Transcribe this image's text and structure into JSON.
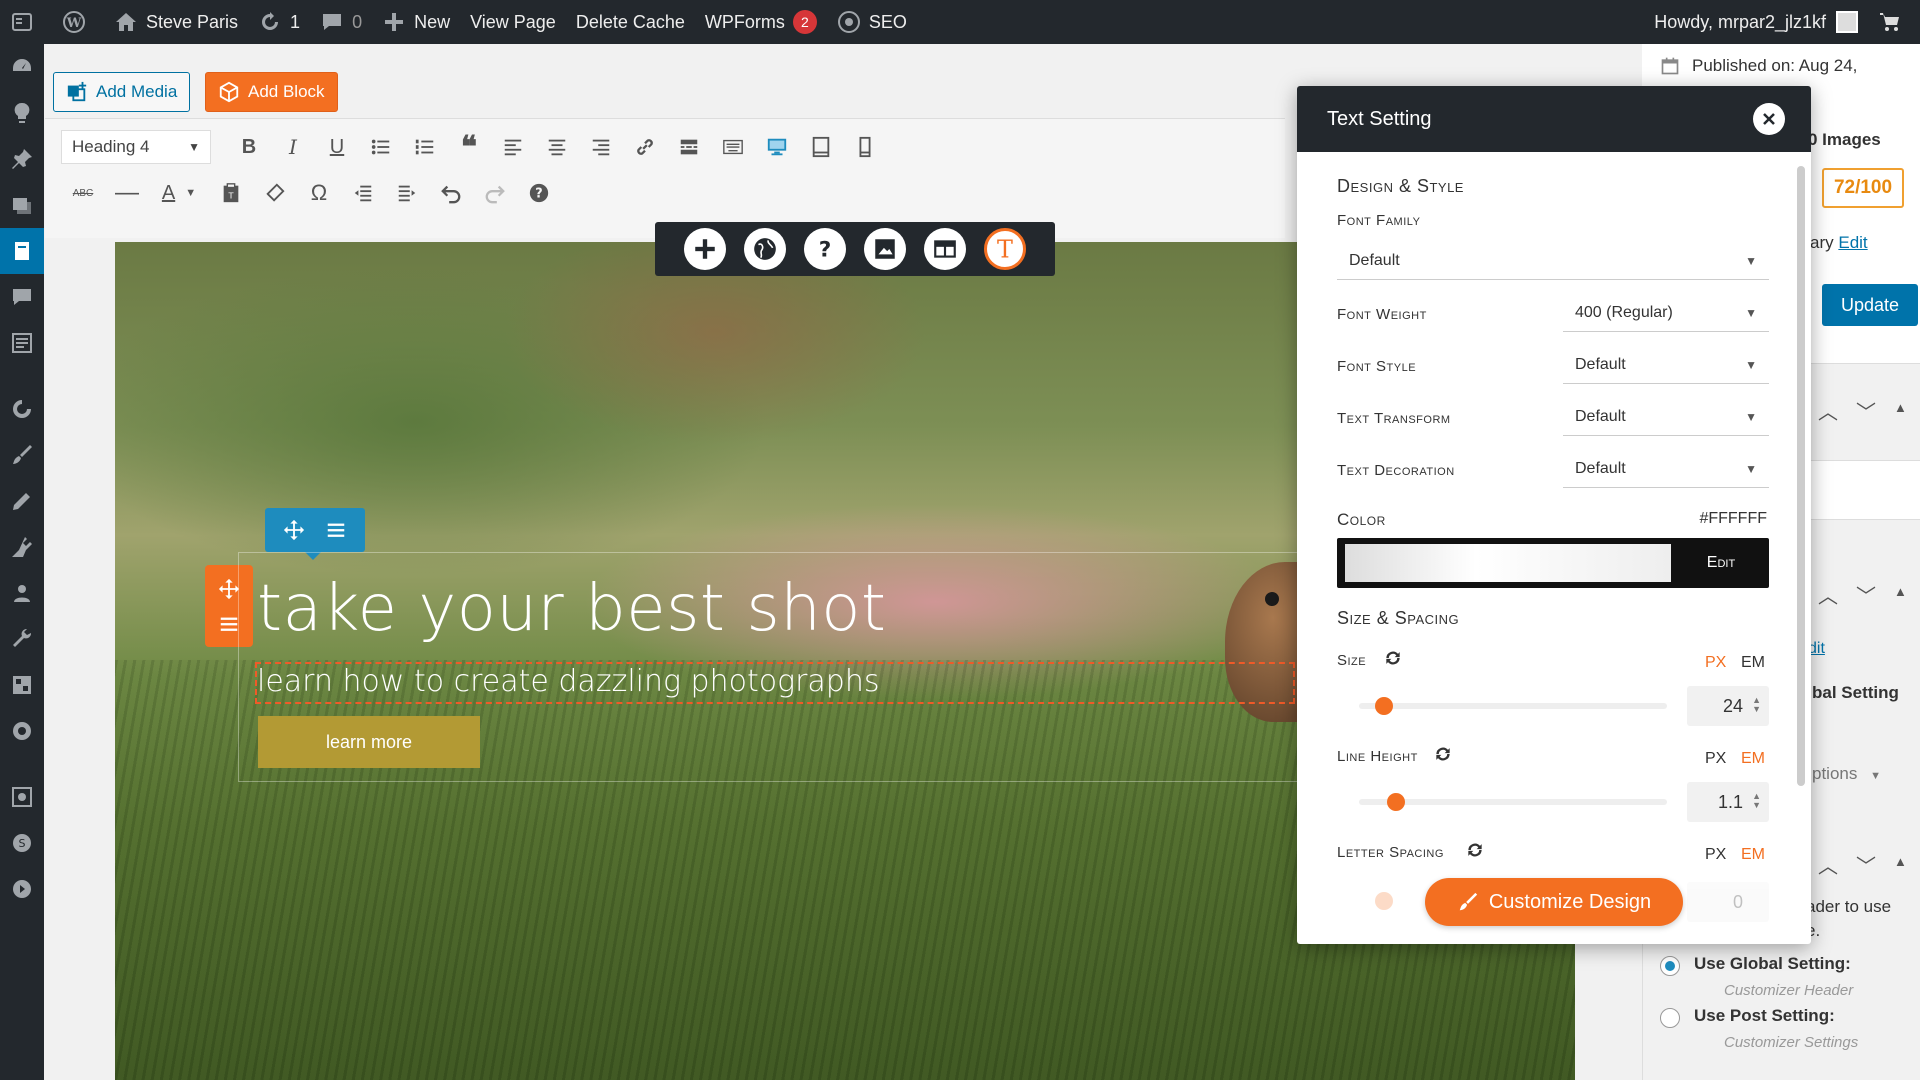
{
  "adminbar": {
    "site_name": "Steve Paris",
    "updates_count": "1",
    "comments_count": "0",
    "new_label": "New",
    "view_page_label": "View Page",
    "delete_cache_label": "Delete Cache",
    "wpforms_label": "WPForms",
    "wpforms_badge": "2",
    "seo_label": "SEO",
    "howdy": "Howdy, mrpar2_jlz1kf"
  },
  "editor": {
    "add_media_label": "Add Media",
    "add_block_label": "Add Block",
    "heading_select": "Heading 4"
  },
  "hero": {
    "title": "take your best shot",
    "subtitle": "learn how to create dazzling photographs",
    "button_label": "learn more"
  },
  "sidebar": {
    "published_on": "Published on: Aug 24,",
    "images_count": "0 Images",
    "score": "72/100",
    "library_text": "ary",
    "edit_link": "Edit",
    "update_label": "Update",
    "edit_link_2": "dit",
    "global_setting": "bal Setting",
    "options": "ptions",
    "header_help_line1": "ader to use",
    "header_help_line2": "e.",
    "use_global": "Use Global Setting:",
    "use_global_sub": "Customizer Header",
    "use_post": "Use Post Setting:",
    "use_post_sub": "Customizer Settings"
  },
  "modal": {
    "title": "Text Setting",
    "design_style": "Design & Style",
    "font_family_label": "Font Family",
    "font_family_value": "Default",
    "font_weight_label": "Font Weight",
    "font_weight_value": "400 (Regular)",
    "font_style_label": "Font Style",
    "font_style_value": "Default",
    "text_transform_label": "Text Transform",
    "text_transform_value": "Default",
    "text_decoration_label": "Text Decoration",
    "text_decoration_value": "Default",
    "color_label": "Color",
    "color_value": "#FFFFFF",
    "color_edit": "Edit",
    "size_spacing": "Size & Spacing",
    "size_label": "Size",
    "size_value": "24",
    "line_height_label": "Line Height",
    "line_height_value": "1.1",
    "letter_spacing_label": "Letter Spacing",
    "letter_spacing_value": "0",
    "unit_px": "PX",
    "unit_em": "EM",
    "customize_label": "Customize Design"
  },
  "colors": {
    "accent_orange": "#f36f21",
    "wp_blue": "#0073aa",
    "admin_dark": "#23282d"
  }
}
